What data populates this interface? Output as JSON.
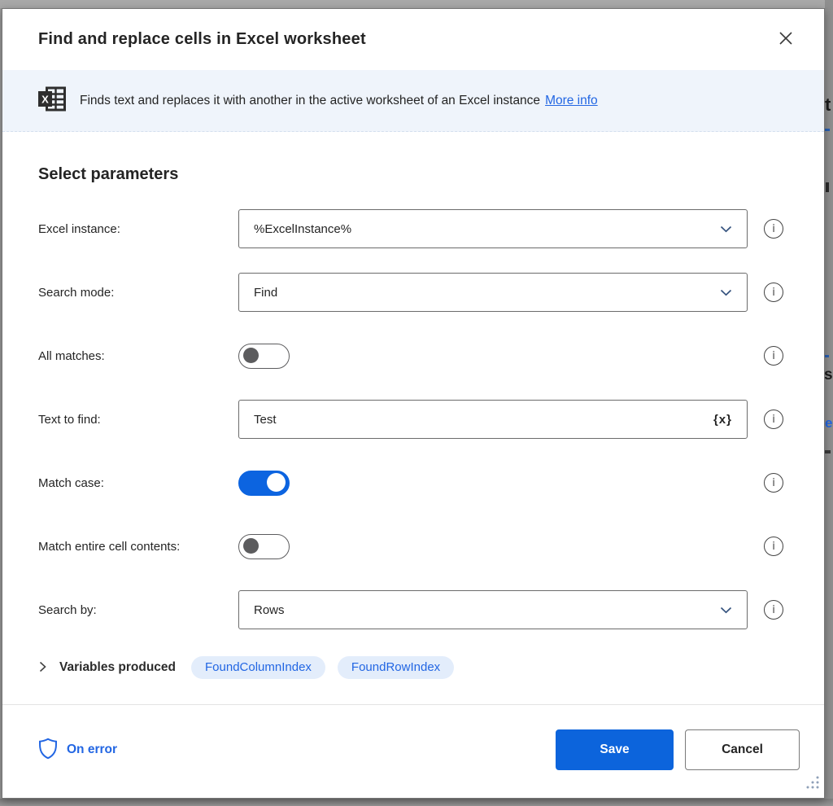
{
  "window": {
    "title": "Find and replace cells in Excel worksheet"
  },
  "banner": {
    "text": "Finds text and replaces it with another in the active worksheet of an Excel instance",
    "more_info_label": "More info"
  },
  "section_title": "Select parameters",
  "parameters": [
    {
      "label": "Excel instance:",
      "control": "combobox",
      "value": "%ExcelInstance%"
    },
    {
      "label": "Search mode:",
      "control": "combobox",
      "value": "Find"
    },
    {
      "label": "All matches:",
      "control": "toggle",
      "on": false
    },
    {
      "label": "Text to find:",
      "control": "text-input",
      "value": "Test",
      "variable_picker": "{x}"
    },
    {
      "label": "Match case:",
      "control": "toggle",
      "on": true
    },
    {
      "label": "Match entire cell contents:",
      "control": "toggle",
      "on": false
    },
    {
      "label": "Search by:",
      "control": "combobox",
      "value": "Rows"
    }
  ],
  "variables_produced": {
    "label": "Variables produced",
    "chips": [
      "FoundColumnIndex",
      "FoundRowIndex"
    ]
  },
  "footer": {
    "on_error_label": "On error",
    "save_label": "Save",
    "cancel_label": "Cancel"
  },
  "icons": {
    "info": "i",
    "excel": "excel-grid-icon",
    "close": "close-x",
    "shield": "on-error-shield",
    "chevron_down": "combobox-chevron",
    "chevron_right": "expander-chevron",
    "resize": "resize-gripper"
  },
  "background_fragments": {
    "a": "t",
    "b": "s",
    "c": "e"
  },
  "colors": {
    "accent_blue": "#0c64dc",
    "toggle_on_blue": "#0c64e0",
    "link_blue": "#2266e3",
    "banner_bg": "#eff4fb",
    "chip_bg": "#e3edfb",
    "page_bg": "#9b9b9b",
    "field_border": "#6b6b6b",
    "text_primary": "#242424"
  }
}
